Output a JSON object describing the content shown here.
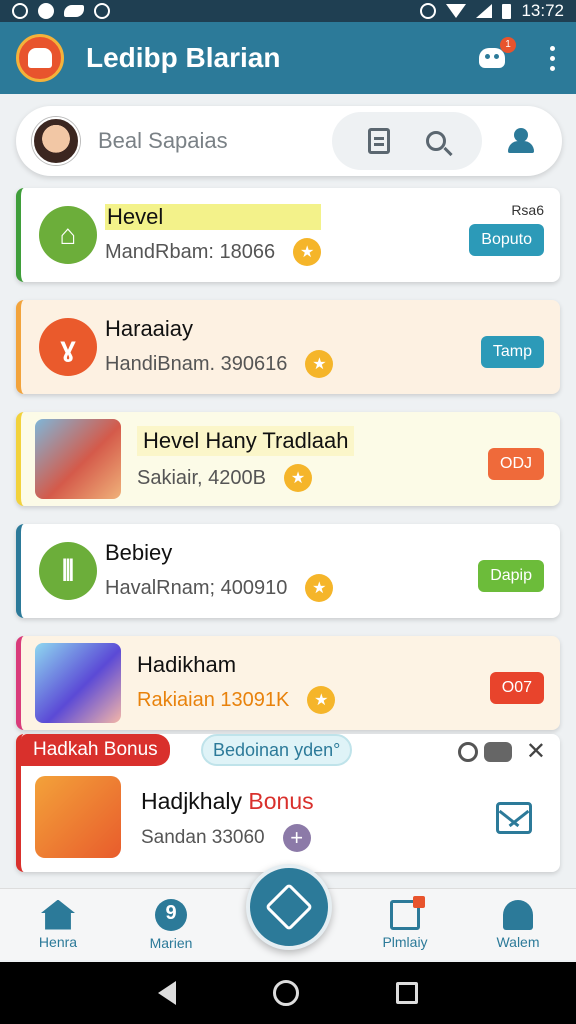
{
  "status_bar": {
    "time": "13:72"
  },
  "app_bar": {
    "title": "Ledibp Blarian",
    "notification_count": "1"
  },
  "search": {
    "placeholder": "Beal Sapaias"
  },
  "cards": [
    {
      "title": "Hevel",
      "subtitle": "MandRbam: 18066",
      "meta": "Rsa6",
      "button": "Boputo",
      "accent": "#3f9e3a",
      "bg": "#ffffff",
      "button_color": "#2c9ab8",
      "icon": "trash-icon",
      "icon_color": "#6cae3a"
    },
    {
      "title": "Haraaiay",
      "subtitle": "HandiBnam. 390616",
      "button": "Tamp",
      "accent": "#f2a33b",
      "bg": "#fdf1e2",
      "button_color": "#2c9ab8",
      "icon": "hands-icon",
      "icon_color": "#ea5a2c"
    },
    {
      "title": "Hevel Hany Tradlaah",
      "subtitle": "Sakiair, 4200B",
      "button": "ODJ",
      "accent": "#f2d23b",
      "bg": "#fcfbe7",
      "button_color": "#ef6a3a",
      "icon": "children-photo"
    },
    {
      "title": "Bebiey",
      "subtitle": "HavalRnam; 400910",
      "button": "Dapip",
      "accent": "#2c7a99",
      "bg": "#ffffff",
      "button_color": "#6cbc3a",
      "icon": "book-stack-icon",
      "icon_color": "#6cae3a"
    },
    {
      "title": "Hadikham",
      "subtitle": "Rakiaian 13091K",
      "button": "O07",
      "accent": "#d93b7a",
      "bg": "#fdf3e4",
      "button_color": "#e8442c",
      "icon": "book-photo",
      "subtitle_color": "#e8820c"
    }
  ],
  "bonus": {
    "tag": "Hadkah Bonus",
    "chip": "Bedoinan yden°",
    "title_main": "Hadjkhaly ",
    "title_accent": "Bonus",
    "subtitle": "Sandan 33060"
  },
  "bottom_nav": [
    {
      "label": "Henra",
      "icon": "home-icon"
    },
    {
      "label": "Marien",
      "icon": "map-pin-icon"
    },
    {
      "label": "Plmlaiy",
      "icon": "document-icon"
    },
    {
      "label": "Walem",
      "icon": "user-icon"
    }
  ],
  "colors": {
    "primary": "#2c7a99",
    "status_bar": "#1f3f52",
    "bonus_red": "#d9302c"
  }
}
